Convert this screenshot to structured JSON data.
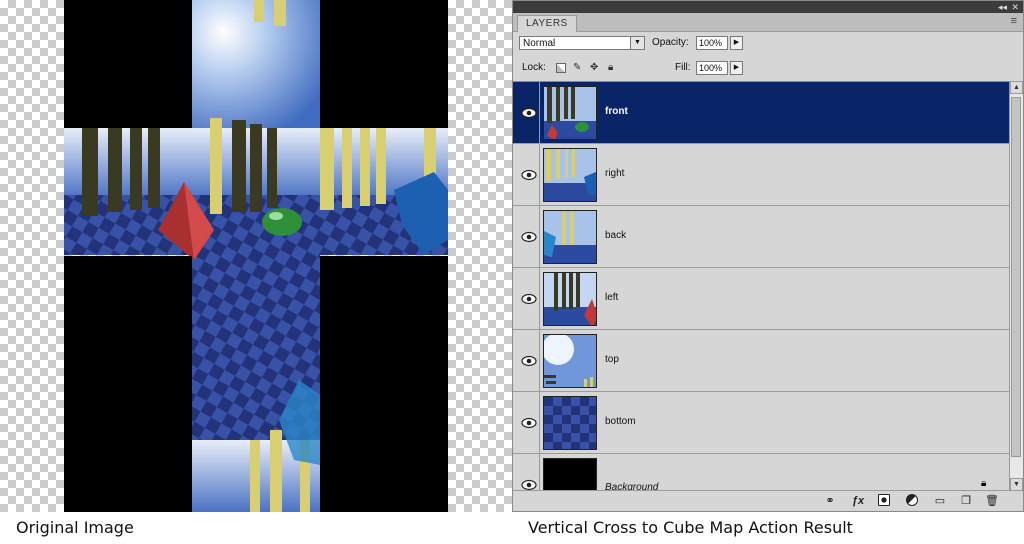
{
  "captions": {
    "left": "Original Image",
    "right": "Vertical Cross to Cube Map Action Result"
  },
  "panel": {
    "tab_label": "LAYERS",
    "blend_mode": "Normal",
    "opacity_label": "Opacity:",
    "opacity_value": "100%",
    "lock_label": "Lock:",
    "fill_label": "Fill:",
    "fill_value": "100%",
    "selected_color": "#0a2468",
    "layers": [
      {
        "name": "front",
        "selected": true
      },
      {
        "name": "right",
        "selected": false
      },
      {
        "name": "back",
        "selected": false
      },
      {
        "name": "left",
        "selected": false
      },
      {
        "name": "top",
        "selected": false
      },
      {
        "name": "bottom",
        "selected": false
      },
      {
        "name": "Background",
        "selected": false
      }
    ],
    "bottom_icons": [
      "link-icon",
      "fx-icon",
      "layer-mask-icon",
      "adjustment-layer-icon",
      "new-group-icon",
      "new-layer-icon",
      "trash-icon"
    ],
    "titlebar_icons": [
      "collapse-icon",
      "close-icon"
    ]
  }
}
